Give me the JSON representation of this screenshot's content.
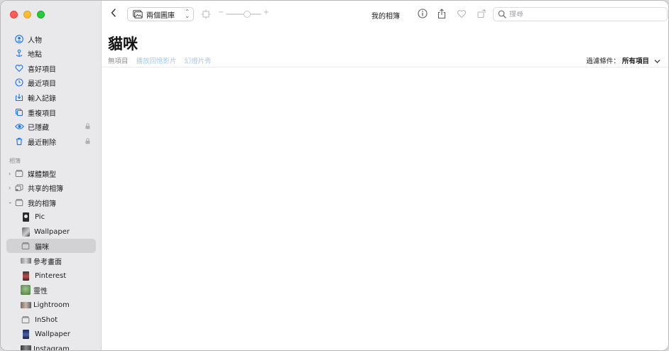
{
  "toolbar": {
    "view_label": "兩個圖庫",
    "title": "我的相簿",
    "search_placeholder": "搜尋"
  },
  "page": {
    "title": "貓咪",
    "item_count": "無項目",
    "play_memory": "播放回憶影片",
    "slideshow": "幻燈片秀",
    "filter_label": "過濾條件：",
    "filter_value": "所有項目"
  },
  "sidebar": {
    "library": [
      {
        "label": "人物",
        "icon": "person-circle-icon"
      },
      {
        "label": "地點",
        "icon": "pin-icon"
      },
      {
        "label": "喜好項目",
        "icon": "heart-icon"
      },
      {
        "label": "最近項目",
        "icon": "clock-icon"
      },
      {
        "label": "輸入記錄",
        "icon": "import-icon"
      },
      {
        "label": "重複項目",
        "icon": "duplicate-icon"
      },
      {
        "label": "已隱藏",
        "icon": "eye-icon"
      },
      {
        "label": "最近刪除",
        "icon": "trash-icon"
      }
    ],
    "section_title": "相簿",
    "groups": [
      {
        "label": "媒體類型"
      },
      {
        "label": "共享的相簿"
      },
      {
        "label": "我的相簿"
      }
    ],
    "albums": [
      {
        "label": "Pic"
      },
      {
        "label": "Wallpaper"
      },
      {
        "label": "貓咪"
      },
      {
        "label": "參考畫面"
      },
      {
        "label": "Pinterest"
      },
      {
        "label": "靈性"
      },
      {
        "label": "Lightroom"
      },
      {
        "label": "InShot"
      },
      {
        "label": "Wallpaper"
      },
      {
        "label": "Instagram"
      }
    ]
  },
  "colors": {
    "accent": "#1a73e8",
    "sidebar_bg": "#e9e9eb",
    "selected_bg": "#d2d2d4"
  }
}
